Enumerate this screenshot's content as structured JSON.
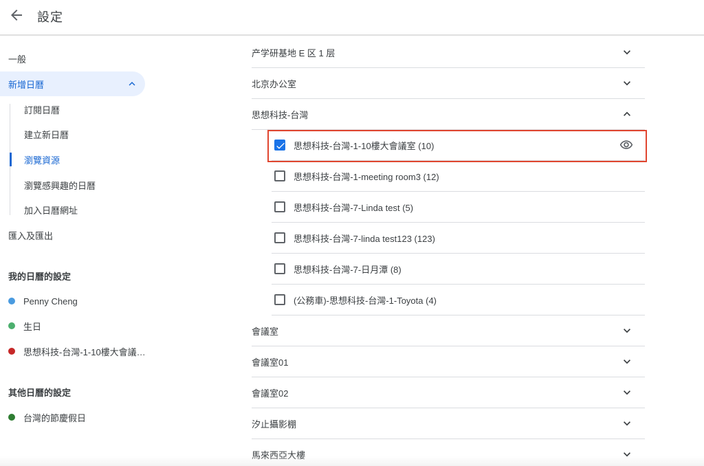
{
  "header": {
    "title": "設定"
  },
  "sidebar": {
    "general": "一般",
    "add_calendar": "新增日曆",
    "sub_items": [
      "訂閱日曆",
      "建立新日曆",
      "瀏覽資源",
      "瀏覽感興趣的日曆",
      "加入日曆網址"
    ],
    "import_export": "匯入及匯出",
    "my_calendars_heading": "我的日曆的設定",
    "my_calendars": [
      {
        "name": "Penny Cheng",
        "color": "#4a9be0"
      },
      {
        "name": "生日",
        "color": "#4caf6e"
      },
      {
        "name": "思想科技-台灣-1-10樓大會議…",
        "color": "#c62828"
      }
    ],
    "other_calendars_heading": "其他日曆的設定",
    "other_calendars": [
      {
        "name": "台灣的節慶假日",
        "color": "#2e7d32"
      }
    ]
  },
  "main": {
    "groups_top": [
      "产学研基地 E 区 1 层",
      "北京办公室",
      "思想科技-台灣"
    ],
    "resources": [
      {
        "label": "思想科技-台灣-1-10樓大會議室 (10)",
        "checked": true
      },
      {
        "label": "思想科技-台灣-1-meeting room3 (12)",
        "checked": false
      },
      {
        "label": "思想科技-台灣-7-Linda test (5)",
        "checked": false
      },
      {
        "label": "思想科技-台灣-7-linda test123 (123)",
        "checked": false
      },
      {
        "label": "思想科技-台灣-7-日月潭 (8)",
        "checked": false
      },
      {
        "label": "(公務車)-思想科技-台灣-1-Toyota (4)",
        "checked": false
      }
    ],
    "groups_bottom": [
      "會議室",
      "會議室01",
      "會議室02",
      "汐止攝影棚",
      "馬來西亞大樓"
    ]
  },
  "colors": {
    "accent": "#1a73e8",
    "highlight_border": "#e0452f"
  }
}
